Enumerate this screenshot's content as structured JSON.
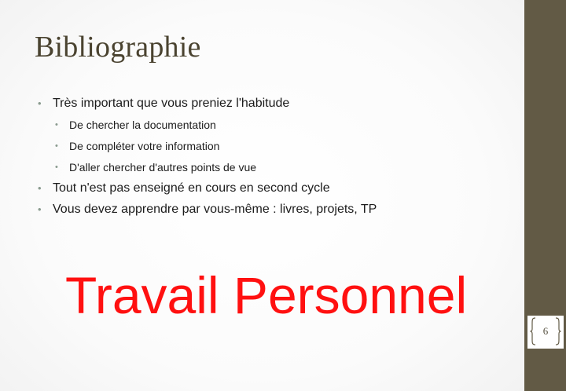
{
  "slide": {
    "title": "Bibliographie",
    "bullets": [
      {
        "text": "Très important que vous preniez l'habitude",
        "level": 1
      },
      {
        "text": "De chercher la documentation",
        "level": 2
      },
      {
        "text": "De compléter votre information",
        "level": 2
      },
      {
        "text": "D'aller chercher d'autres points de vue",
        "level": 2
      },
      {
        "text": "Tout n'est pas enseigné en cours en second cycle",
        "level": 1
      },
      {
        "text": "Vous devez apprendre par vous-même : livres, projets, TP",
        "level": 1
      }
    ],
    "highlight": "Travail Personnel",
    "page_number": "6"
  },
  "colors": {
    "title": "#4a4330",
    "highlight": "#ff1010",
    "side_band": "#625a45",
    "bullet_dot": "#8a9b8f"
  }
}
